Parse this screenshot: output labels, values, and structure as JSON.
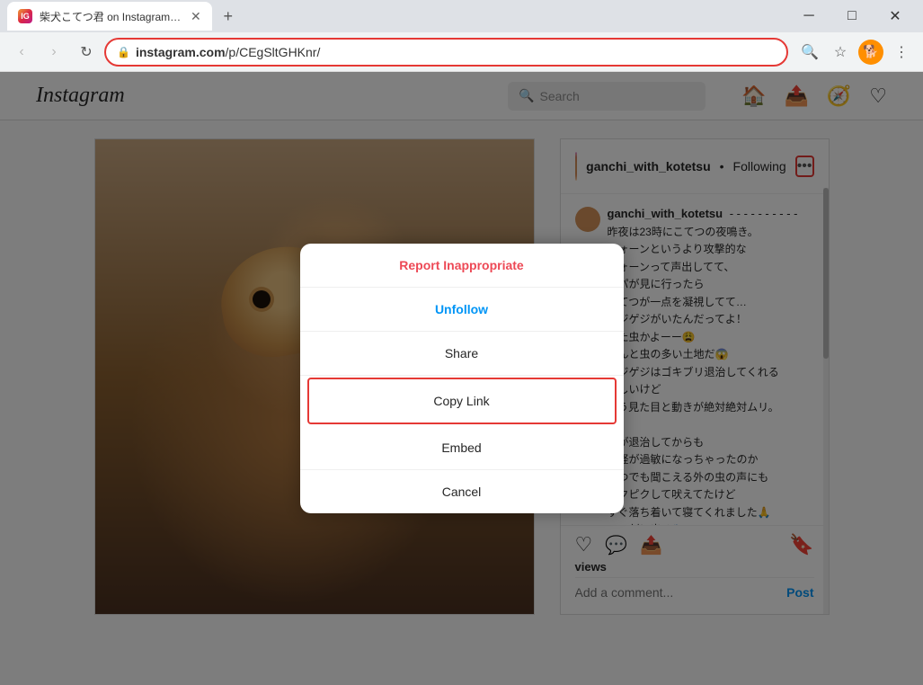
{
  "browser": {
    "tab": {
      "favicon": "IG",
      "title": "柴犬こてつ君 on Instagram: \"- - - ×"
    },
    "new_tab_label": "+",
    "window_controls": {
      "minimize": "─",
      "maximize": "□",
      "close": "✕"
    },
    "toolbar": {
      "back_label": "‹",
      "forward_label": "›",
      "reload_label": "↻",
      "url": "instagram.com/p/CEgSltGHKnr/",
      "url_bold": "instagram.com",
      "url_rest": "/p/CEgSltGHKnr/",
      "search_icon": "🔍",
      "star_icon": "☆",
      "avatar_icon": "🐕",
      "menu_icon": "⋮"
    }
  },
  "instagram": {
    "header": {
      "logo": "Instagram",
      "search_placeholder": "Search",
      "search_icon": "🔍",
      "nav_icons": [
        "🏠",
        "📤",
        "🧭",
        "♡"
      ]
    },
    "post": {
      "username": "ganchi_with_kotetsu",
      "following": "Following",
      "more_options_label": "•••",
      "comments_username": "ganchi_with_kotetsu",
      "comments_dashes": "- - - - - - - - - -",
      "comment_text": "昨夜は23時にこてつの夜鳴き。\nクォーンというより攻撃的な\nヴォーンって声出してて、\nパパが見に行ったら\nこてつが一点を凝視してて…\nゲジゲジがいたんだってよ！\nまた虫かよーー😩\nほんと虫の多い土地だ😱\nゲジゲジはゴキブリ退治してくれる\nらしいけど\nもう見た目と動きが絶対絶対ムリ。\n\n虫が退治してからも\n神経が過敏になっちゃったのか\nいつでも聞こえる外の虫の声にも\nピクピクして吠えてたけど\nすぐ落ち着いて寝てくれました🙏\n…の割に出る🐾",
      "action_icons": {
        "comment": "💬",
        "share": "📤",
        "save": "🔖"
      },
      "views": "views",
      "add_comment_placeholder": "Add a comment...",
      "post_button": "Post"
    }
  },
  "modal": {
    "items": [
      {
        "label": "Report Inappropriate",
        "type": "danger"
      },
      {
        "label": "Unfollow",
        "type": "blue"
      },
      {
        "label": "Share",
        "type": "normal"
      },
      {
        "label": "Copy Link",
        "type": "highlighted"
      },
      {
        "label": "Embed",
        "type": "normal"
      },
      {
        "label": "Cancel",
        "type": "normal"
      }
    ]
  }
}
